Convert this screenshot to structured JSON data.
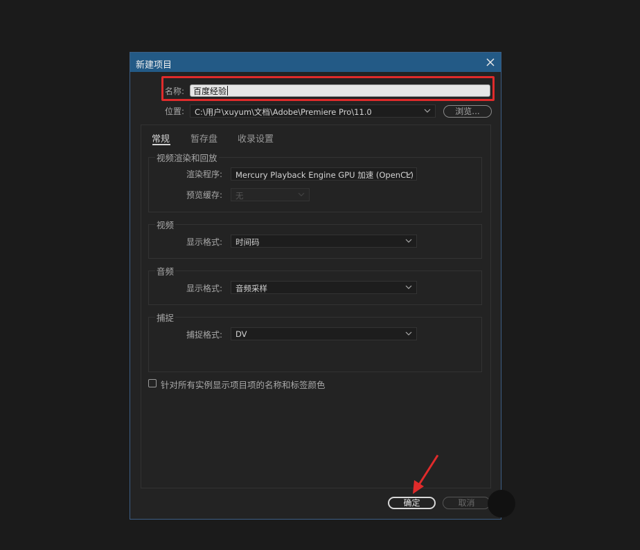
{
  "dialog": {
    "title": "新建项目",
    "name_label": "名称:",
    "name_value": "百度经验",
    "location_label": "位置:",
    "location_value": "C:\\用户\\xuyum\\文档\\Adobe\\Premiere Pro\\11.0",
    "browse_label": "浏览...",
    "tabs": [
      {
        "label": "常规"
      },
      {
        "label": "暂存盘"
      },
      {
        "label": "收录设置"
      }
    ],
    "video_rendering": {
      "title": "视频渲染和回放",
      "renderer_label": "渲染程序:",
      "renderer_value": "Mercury Playback Engine GPU 加速 (OpenCL)",
      "preview_cache_label": "预览缓存:",
      "preview_cache_value": "无"
    },
    "video": {
      "title": "视频",
      "display_format_label": "显示格式:",
      "display_format_value": "时间码"
    },
    "audio": {
      "title": "音频",
      "display_format_label": "显示格式:",
      "display_format_value": "音频采样"
    },
    "capture": {
      "title": "捕捉",
      "capture_format_label": "捕捉格式:",
      "capture_format_value": "DV"
    },
    "checkbox_label": "针对所有实例显示项目项的名称和标签颜色",
    "ok_label": "确定",
    "cancel_label": "取消"
  },
  "colors": {
    "titlebar": "#235a86",
    "highlight": "#e02b2b",
    "background": "#232323"
  }
}
